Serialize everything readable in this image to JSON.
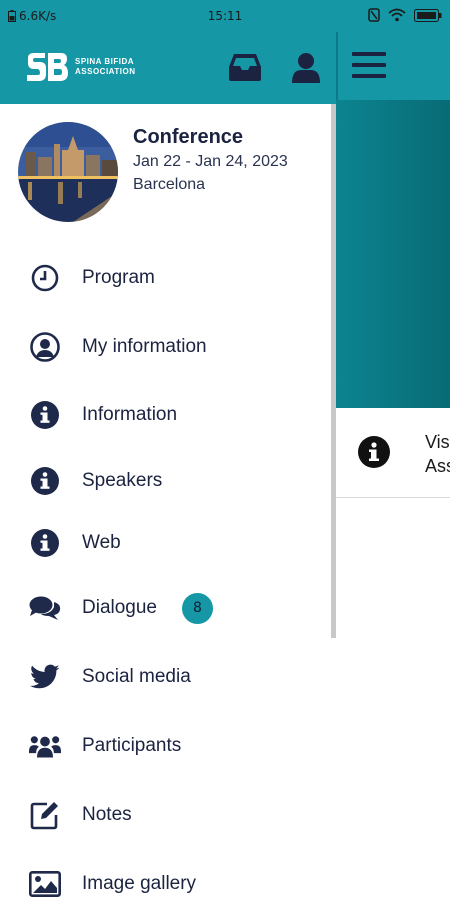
{
  "status_bar": {
    "net_speed": "6.6K/s",
    "time": "15:11"
  },
  "colors": {
    "accent": "#1597a5",
    "text": "#1b2340",
    "icon": "#1f2a4a"
  },
  "header": {
    "logo_line1": "SPINA BIFIDA",
    "logo_line2": "ASSOCIATION",
    "icons": [
      "inbox-icon",
      "user-icon"
    ]
  },
  "conference": {
    "title": "Conference",
    "dates": "Jan 22 - Jan 24, 2023",
    "city": "Barcelona"
  },
  "menu": [
    {
      "label": "Program",
      "icon": "clock-icon"
    },
    {
      "label": "My information",
      "icon": "user-circle-icon"
    },
    {
      "label": "Information",
      "icon": "info-icon"
    },
    {
      "label": "Speakers",
      "icon": "info-icon"
    },
    {
      "label": "Web",
      "icon": "info-icon"
    },
    {
      "label": "Dialogue",
      "icon": "chat-icon",
      "badge": "8"
    },
    {
      "label": "Social media",
      "icon": "twitter-icon"
    },
    {
      "label": "Participants",
      "icon": "users-icon"
    },
    {
      "label": "Notes",
      "icon": "edit-icon"
    },
    {
      "label": "Image gallery",
      "icon": "image-icon"
    }
  ],
  "background_card": {
    "line1": "Vis",
    "line2": "Ass"
  }
}
